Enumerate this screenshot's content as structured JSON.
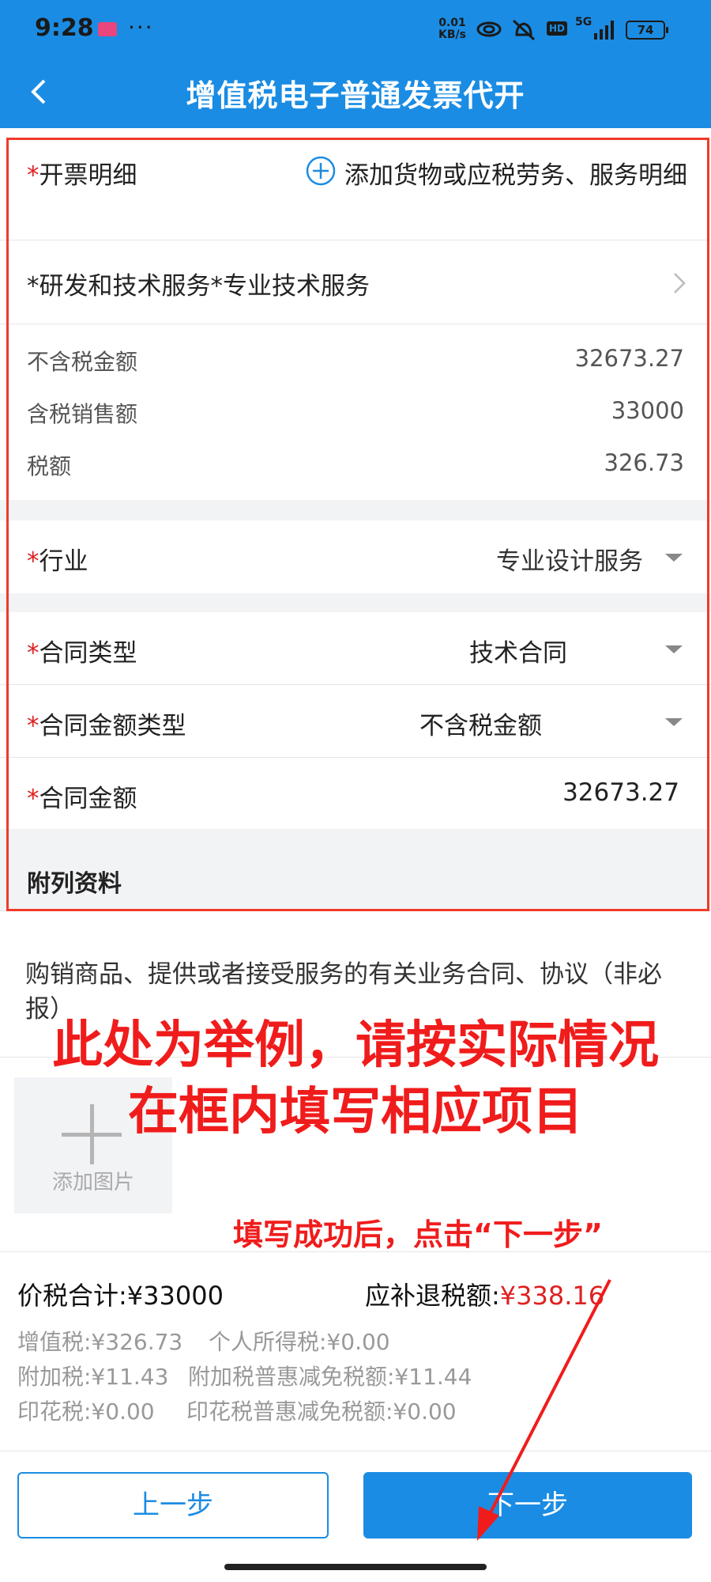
{
  "status_bar": {
    "time": "9:28",
    "dots": "···",
    "speed_value": "0.01",
    "speed_unit": "KB/s",
    "hd": "HD",
    "network": "5G",
    "battery": "74"
  },
  "nav": {
    "title": "增值税电子普通发票代开"
  },
  "invoice": {
    "detail_label": "开票明细",
    "add_item_label": "添加货物或应税劳务、服务明细",
    "item_name": "*研发和技术服务*专业技术服务",
    "amount_excl_tax_label": "不含税金额",
    "amount_excl_tax": "32673.27",
    "amount_incl_tax_label": "含税销售额",
    "amount_incl_tax": "33000",
    "tax_label": "税额",
    "tax": "326.73"
  },
  "form": {
    "required_mark": "*",
    "industry_label": "行业",
    "industry_value": "专业设计服务",
    "contract_type_label": "合同类型",
    "contract_type_value": "技术合同",
    "contract_amount_type_label": "合同金额类型",
    "contract_amount_type_value": "不含税金额",
    "contract_amount_label": "合同金额",
    "contract_amount_value": "32673.27"
  },
  "attachments": {
    "section_title": "附列资料",
    "description": "购销商品、提供或者接受服务的有关业务合同、协议（非必报）",
    "add_image_label": "添加图片"
  },
  "annotations": {
    "line1": "此处为举例，请按实际情况",
    "line2": "在框内填写相应项目",
    "hint": "填写成功后，点击“下一步”"
  },
  "summary": {
    "total_label": "价税合计:",
    "total_value": "¥33000",
    "refund_label": "应补退税额:",
    "refund_value": "¥338.16",
    "vat": "增值税:¥326.73",
    "personal_income_tax": "个人所得税:¥0.00",
    "surtax": "附加税:¥11.43",
    "surtax_relief": "附加税普惠减免税额:¥11.44",
    "stamp_tax": "印花税:¥0.00",
    "stamp_tax_relief": "印花税普惠减免税额:¥0.00"
  },
  "buttons": {
    "prev": "上一步",
    "next": "下一步"
  },
  "colors": {
    "primary": "#1b8ce3",
    "required": "#e02020",
    "annotation": "#f01c1c"
  }
}
